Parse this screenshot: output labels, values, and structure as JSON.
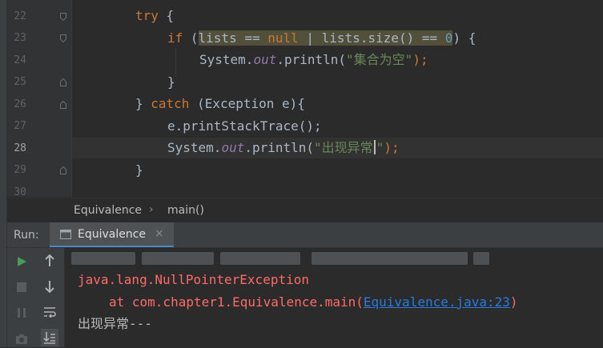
{
  "editor": {
    "line_numbers": [
      "22",
      "23",
      "24",
      "25",
      "26",
      "27",
      "28",
      "29",
      "30"
    ],
    "current_line": "28",
    "lines": {
      "l22": {
        "kw_try": "try",
        "brace": " {"
      },
      "l23": {
        "kw_if": "if",
        "p1": " (",
        "hl_a": "lists == ",
        "null": "null",
        "hl_b": " | lists.size() == ",
        "zero": "0",
        "p2": ") {"
      },
      "l24": {
        "a": "System.",
        "out": "out",
        "b": ".println(",
        "str": "\"集合为空\"",
        "c": ");"
      },
      "l25": {
        "brace": "}"
      },
      "l26": {
        "a": "} ",
        "kw_catch": "catch",
        "b": " (Exception e){"
      },
      "l27": {
        "a": "e.printStackTrace();"
      },
      "l28": {
        "a": "System.",
        "out": "out",
        "b": ".println(",
        "str_a": "\"出现异常",
        "str_b": "\"",
        "c": ");"
      },
      "l29": {
        "brace": "}"
      }
    }
  },
  "breadcrumb": {
    "class_name": "Equivalence",
    "separator": "›",
    "method": "main()"
  },
  "run": {
    "label": "Run:",
    "tab_label": "Equivalence",
    "tab_close": "×",
    "icons": [
      "rerun-icon",
      "stop-icon",
      "pause-icon",
      "camera-icon",
      "scroll-up-icon",
      "scroll-down-icon",
      "soft-wrap-icon",
      "scroll-to-end-icon"
    ]
  },
  "console": {
    "exception": "java.lang.NullPointerException",
    "stack_prefix": "\tat com.chapter1.Equivalence.main(",
    "stack_link": "Equivalence.java:23",
    "stack_suffix": ")",
    "output": "出现异常---"
  },
  "colors": {
    "background": "#2b2b2b",
    "keyword": "#cc7832",
    "string": "#6a8759",
    "field": "#9876aa",
    "number": "#6897bb",
    "error": "#ff6b68",
    "link": "#287bde",
    "run_green": "#499c54"
  }
}
